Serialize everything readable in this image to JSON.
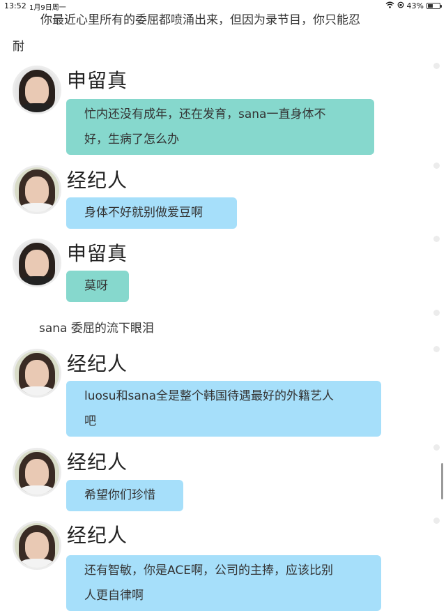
{
  "status_bar": {
    "time": "13:52",
    "date": "1月9日周一",
    "battery": "43%",
    "battery_level": 0.43,
    "icons": [
      "wifi-icon",
      "rotation-lock-icon",
      "battery-icon"
    ]
  },
  "messages": {
    "top_text_line1": "你最近心里所有的委屈都喷涌出来，但因为录节目，你只能忍",
    "top_text_line2": "耐",
    "m1": {
      "speaker": "申留真",
      "line1": "忙内还没有成年，还在发育，sana一直身体不",
      "line2": "好，生病了怎么办"
    },
    "m2": {
      "speaker": "经纪人",
      "line1": "身体不好就别做爱豆啊"
    },
    "m3": {
      "speaker": "申留真",
      "line1": "莫呀"
    },
    "narration": "sana 委屈的流下眼泪",
    "m4": {
      "speaker": "经纪人",
      "line1": "luosu和sana全是整个韩国待遇最好的外籍艺人",
      "line2": "吧"
    },
    "m5": {
      "speaker": "经纪人",
      "line1": "希望你们珍惜"
    },
    "m6": {
      "speaker": "经纪人",
      "line1": "还有智敏，你是ACE啊，公司的主捧，应该比别",
      "line2": "人更自律啊"
    }
  },
  "colors": {
    "bubble_teal": "#86d8cd",
    "bubble_blue": "#a6dffa"
  }
}
